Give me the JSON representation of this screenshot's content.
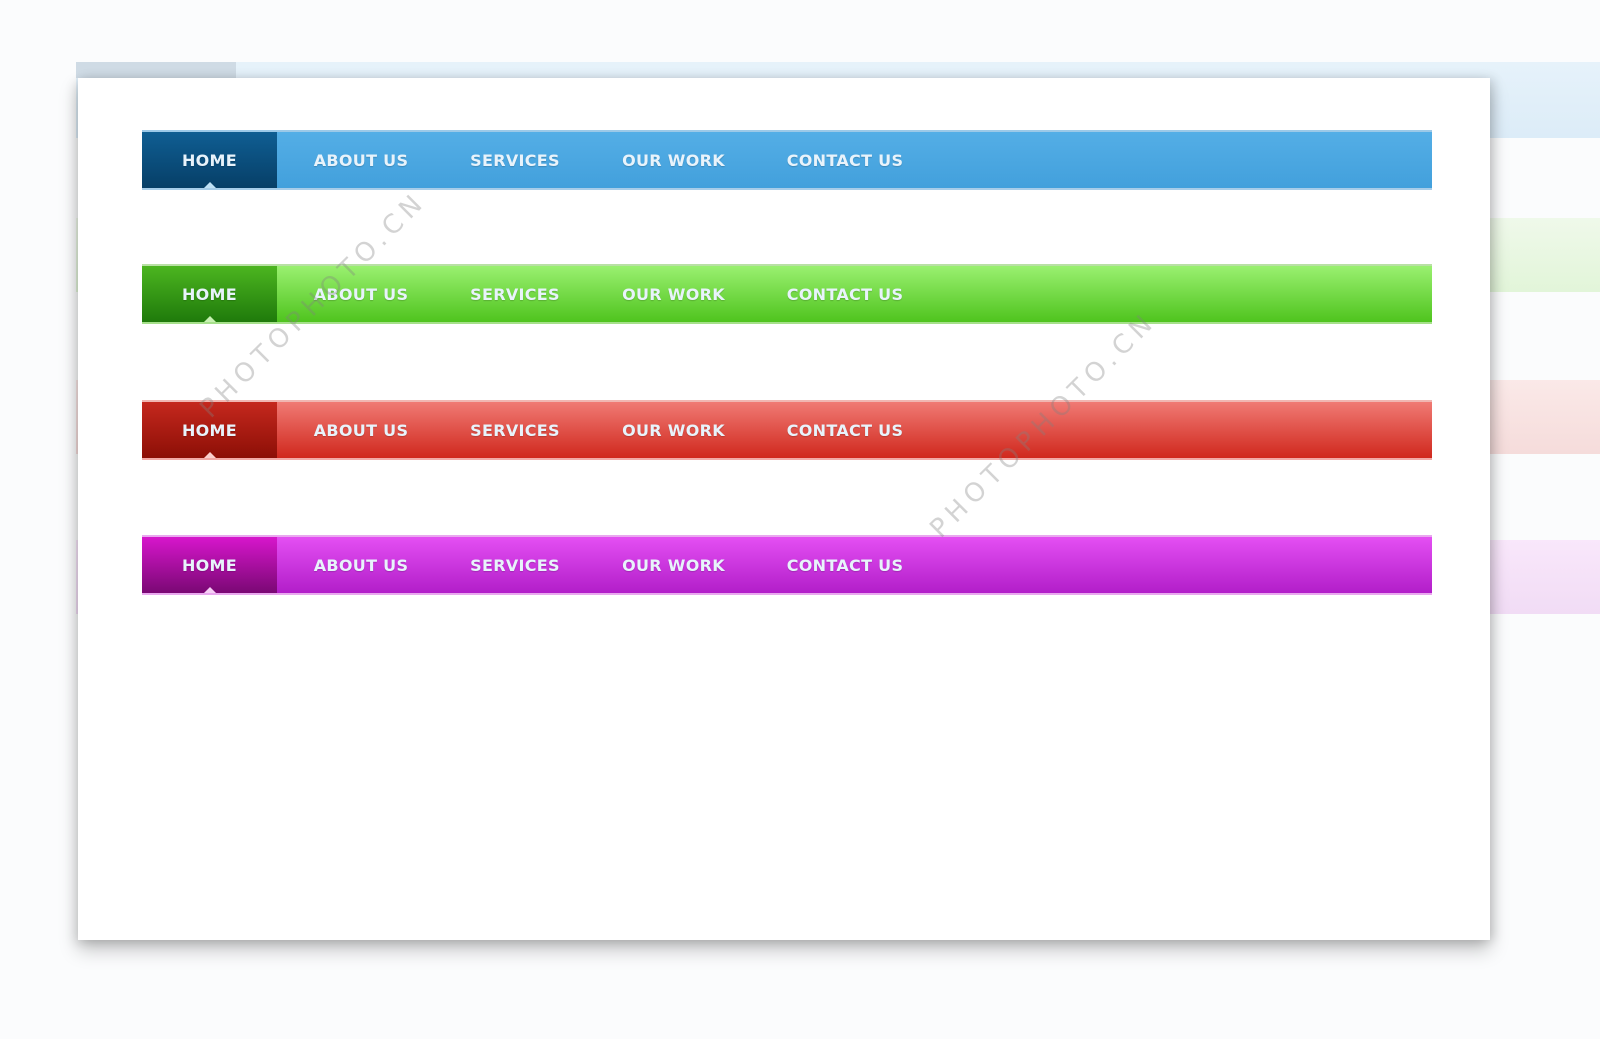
{
  "nav_items": [
    "HOME",
    "ABOUT US",
    "SERVICES",
    "OUR WORK",
    "CONTACT US"
  ],
  "active_item": "HOME",
  "themes": [
    {
      "name": "blue",
      "bar_color": "#4aa6e1",
      "active_color": "#0a4e7e"
    },
    {
      "name": "green",
      "bar_color": "#6cd84a",
      "active_color": "#2e951a"
    },
    {
      "name": "red",
      "bar_color": "#e2514a",
      "active_color": "#a81a10"
    },
    {
      "name": "purple",
      "bar_color": "#cf38e1",
      "active_color": "#a20e9c"
    }
  ],
  "navbars": {
    "blue": {
      "home": "HOME",
      "about": "ABOUT US",
      "services": "SERVICES",
      "work": "OUR WORK",
      "contact": "CONTACT US"
    },
    "green": {
      "home": "HOME",
      "about": "ABOUT US",
      "services": "SERVICES",
      "work": "OUR WORK",
      "contact": "CONTACT US"
    },
    "red": {
      "home": "HOME",
      "about": "ABOUT US",
      "services": "SERVICES",
      "work": "OUR WORK",
      "contact": "CONTACT US"
    },
    "purple": {
      "home": "HOME",
      "about": "ABOUT US",
      "services": "SERVICES",
      "work": "OUR WORK",
      "contact": "CONTACT US"
    }
  },
  "watermark": "PHOTOPHOTO.CN"
}
